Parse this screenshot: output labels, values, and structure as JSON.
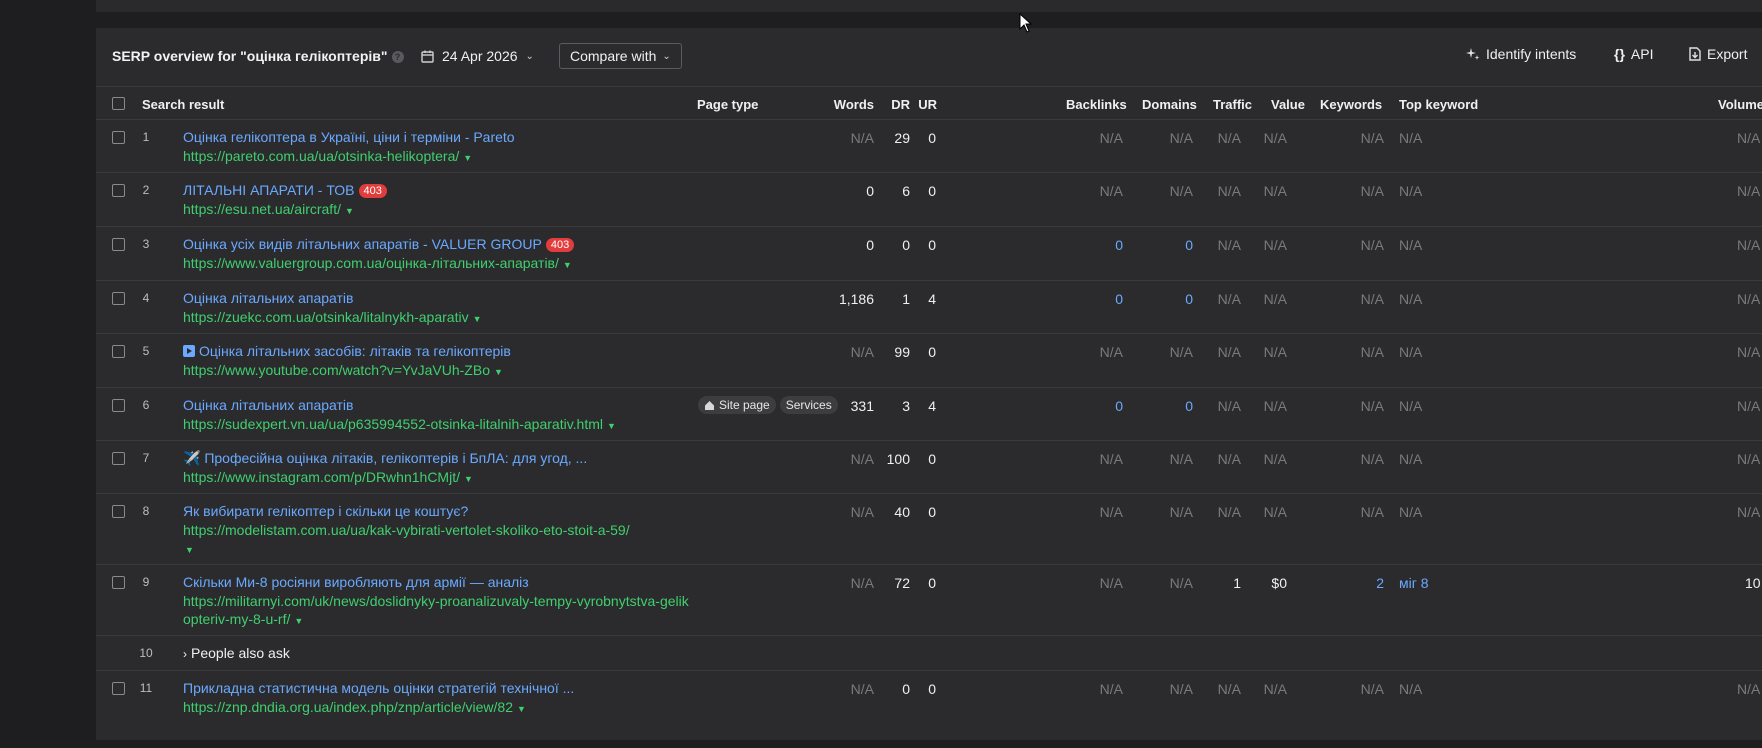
{
  "header": {
    "title": "SERP overview for \"оцінка гелікоптерів\"",
    "help": "?",
    "date": "24 Apr 2026",
    "compare_label": "Compare with",
    "identify_label": "Identify intents",
    "api_label": "API",
    "export_label": "Export"
  },
  "columns": {
    "search_result": "Search result",
    "page_type": "Page type",
    "words": "Words",
    "dr": "DR",
    "ur": "UR",
    "backlinks": "Backlinks",
    "domains": "Domains",
    "traffic": "Traffic",
    "value": "Value",
    "keywords": "Keywords",
    "top_keyword": "Top keyword",
    "volume": "Volume"
  },
  "rows": [
    {
      "num": "1",
      "title": "Оцінка гелікоптера в Україні, ціни і терміни - Pareto",
      "url": "https://pareto.com.ua/ua/otsinka-helikoptera/",
      "words": "N/A",
      "dr": "29",
      "ur": "0",
      "backlinks": "N/A",
      "domains": "N/A",
      "traffic": "N/A",
      "value": "N/A",
      "keywords": "N/A",
      "top_keyword": "N/A",
      "volume": "N/A"
    },
    {
      "num": "2",
      "title": "ЛІТАЛЬНІ АПАРАТИ - ТОВ",
      "badge": "403",
      "url": "https://esu.net.ua/aircraft/",
      "words": "0",
      "dr": "6",
      "ur": "0",
      "backlinks": "N/A",
      "domains": "N/A",
      "traffic": "N/A",
      "value": "N/A",
      "keywords": "N/A",
      "top_keyword": "N/A",
      "volume": "N/A"
    },
    {
      "num": "3",
      "title": "Оцінка усіх видів літальних апаратів - VALUER GROUP",
      "badge": "403",
      "url": "https://www.valuergroup.com.ua/оцінка-літальних-апаратів/",
      "words": "0",
      "dr": "0",
      "ur": "0",
      "backlinks": "0",
      "domains": "0",
      "traffic": "N/A",
      "value": "N/A",
      "keywords": "N/A",
      "top_keyword": "N/A",
      "volume": "N/A"
    },
    {
      "num": "4",
      "title": "Оцінка літальних апаратів",
      "url": "https://zuekc.com.ua/otsinka/litalnykh-aparativ",
      "words": "1,186",
      "dr": "1",
      "ur": "4",
      "backlinks": "0",
      "domains": "0",
      "traffic": "N/A",
      "value": "N/A",
      "keywords": "N/A",
      "top_keyword": "N/A",
      "volume": "N/A"
    },
    {
      "num": "5",
      "title": "Оцінка літальних засобів: літаків та гелікоптерів",
      "url": "https://www.youtube.com/watch?v=YvJaVUh-ZBo",
      "words": "N/A",
      "dr": "99",
      "ur": "0",
      "backlinks": "N/A",
      "domains": "N/A",
      "traffic": "N/A",
      "value": "N/A",
      "keywords": "N/A",
      "top_keyword": "N/A",
      "volume": "N/A"
    },
    {
      "num": "6",
      "title": "Оцінка літальних апаратів",
      "url": "https://sudexpert.vn.ua/ua/p635994552-otsinka-litalnih-aparativ.html",
      "tag1": "Site page",
      "tag2": "Services",
      "words": "331",
      "dr": "3",
      "ur": "4",
      "backlinks": "0",
      "domains": "0",
      "traffic": "N/A",
      "value": "N/A",
      "keywords": "N/A",
      "top_keyword": "N/A",
      "volume": "N/A"
    },
    {
      "num": "7",
      "title": "✈️ Професійна оцінка літаків, гелікоптерів і БпЛА: для угод, ...",
      "url": "https://www.instagram.com/p/DRwhn1hCMjt/",
      "words": "N/A",
      "dr": "100",
      "ur": "0",
      "backlinks": "N/A",
      "domains": "N/A",
      "traffic": "N/A",
      "value": "N/A",
      "keywords": "N/A",
      "top_keyword": "N/A",
      "volume": "N/A"
    },
    {
      "num": "8",
      "title": "Як вибирати гелікоптер і скільки це коштує?",
      "url": "https://modelistam.com.ua/ua/kak-vybirati-vertolet-skoliko-eto-stoit-a-59/",
      "words": "N/A",
      "dr": "40",
      "ur": "0",
      "backlinks": "N/A",
      "domains": "N/A",
      "traffic": "N/A",
      "value": "N/A",
      "keywords": "N/A",
      "top_keyword": "N/A",
      "volume": "N/A"
    },
    {
      "num": "9",
      "title": "Скільки Ми-8 росіяни виробляють для армії — аналіз",
      "url": "https://militarnyi.com/uk/news/doslidnyky-proanalizuvaly-tempy-vyrobnytstva-gelikopteriv-my-8-u-rf/",
      "words": "N/A",
      "dr": "72",
      "ur": "0",
      "backlinks": "N/A",
      "domains": "N/A",
      "traffic": "1",
      "value": "$0",
      "keywords": "2",
      "top_keyword": "міг 8",
      "volume": "10"
    },
    {
      "num": "10",
      "paa": "People also ask"
    },
    {
      "num": "11",
      "title": "Прикладна статистична модель оцінки стратегій технічної ...",
      "url": "https://znp.dndia.org.ua/index.php/znp/article/view/82",
      "words": "N/A",
      "dr": "0",
      "ur": "0",
      "backlinks": "N/A",
      "domains": "N/A",
      "traffic": "N/A",
      "value": "N/A",
      "keywords": "N/A",
      "top_keyword": "N/A",
      "volume": "N/A"
    }
  ]
}
